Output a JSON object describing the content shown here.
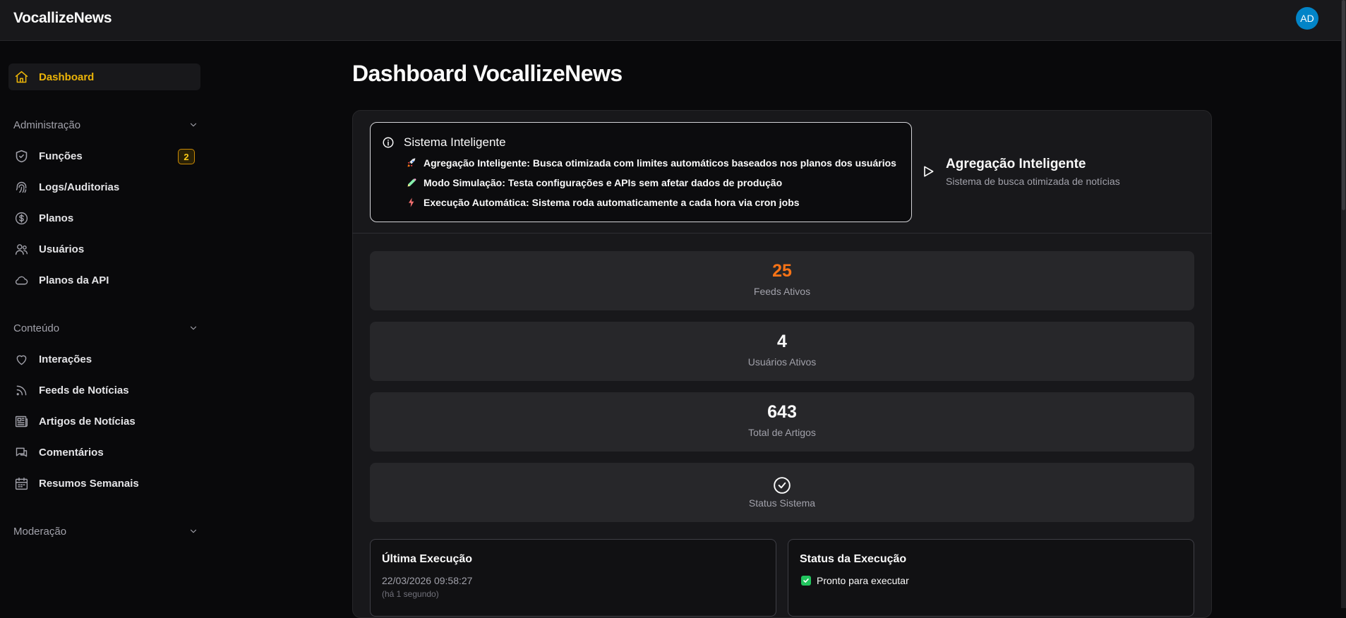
{
  "app": {
    "brand": "VocallizeNews",
    "avatar_initials": "AD",
    "accent": "#eab308",
    "avatar_color": "#0284c7"
  },
  "sidebar": {
    "dashboard": "Dashboard",
    "sections": {
      "admin": "Administração",
      "content": "Conteúdo",
      "moderation": "Moderação"
    },
    "admin_items": [
      {
        "label": "Funções",
        "icon": "shield-check-icon",
        "badge": "2"
      },
      {
        "label": "Logs/Auditorias",
        "icon": "fingerprint-icon"
      },
      {
        "label": "Planos",
        "icon": "dollar-circle-icon"
      },
      {
        "label": "Usuários",
        "icon": "users-icon"
      },
      {
        "label": "Planos da API",
        "icon": "cloud-icon"
      }
    ],
    "content_items": [
      {
        "label": "Interações",
        "icon": "heart-icon"
      },
      {
        "label": "Feeds de Notícias",
        "icon": "rss-icon"
      },
      {
        "label": "Artigos de Notícias",
        "icon": "newspaper-icon"
      },
      {
        "label": "Comentários",
        "icon": "messages-icon"
      },
      {
        "label": "Resumos Semanais",
        "icon": "calendar-icon"
      }
    ]
  },
  "main": {
    "title": "Dashboard VocallizeNews",
    "info": {
      "title": "Sistema Inteligente",
      "lines": [
        {
          "label": "Agregação Inteligente:",
          "text": "Busca otimizada com limites automáticos baseados nos planos dos usuários",
          "icon": "rocket-icon"
        },
        {
          "label": "Modo Simulação:",
          "text": "Testa configurações e APIs sem afetar dados de produção",
          "icon": "pencil-icon"
        },
        {
          "label": "Execução Automática:",
          "text": "Sistema roda automaticamente a cada hora via cron jobs",
          "icon": "lightning-icon"
        }
      ]
    },
    "aggregation": {
      "title": "Agregação Inteligente",
      "subtitle": "Sistema de busca otimizada de notícias"
    },
    "stats": [
      {
        "value": "25",
        "label": "Feeds Ativos",
        "color": "#f97316"
      },
      {
        "value": "4",
        "label": "Usuários Ativos"
      },
      {
        "value": "643",
        "label": "Total de Artigos"
      },
      {
        "value": "",
        "label": "Status Sistema",
        "icon": "check-circle-icon"
      }
    ],
    "last_run": {
      "title": "Última Execução",
      "datetime": "22/03/2026 09:58:27",
      "relative": "(há 1 segundo)"
    },
    "run_status": {
      "title": "Status da Execução",
      "status": "Pronto para executar"
    }
  }
}
